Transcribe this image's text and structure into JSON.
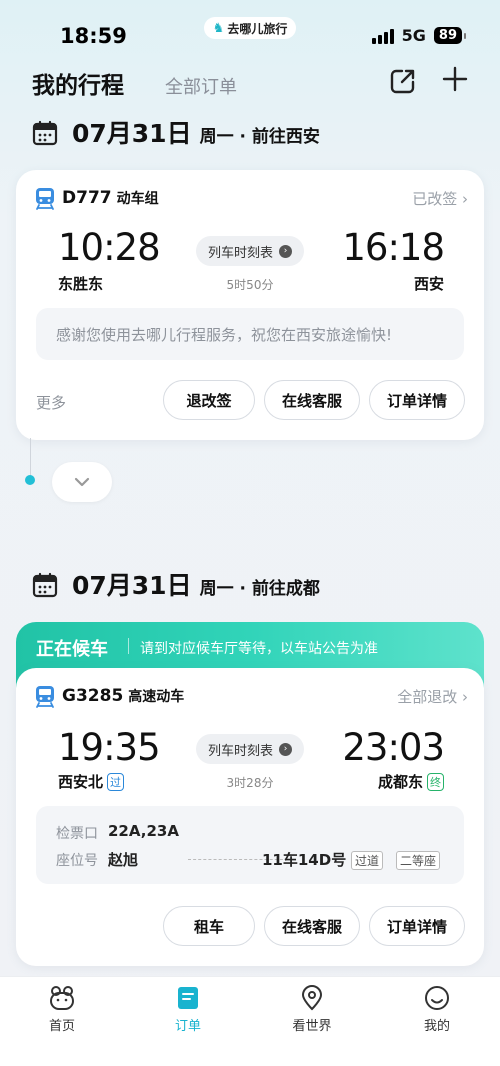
{
  "status_bar": {
    "time": "18:59",
    "app_name": "去哪儿旅行",
    "network": "5G",
    "battery": "89"
  },
  "header": {
    "title": "我的行程",
    "tab_all_orders": "全部订单"
  },
  "trips": [
    {
      "date": "07月31日",
      "weekday_dest": "周一 · 前往西安",
      "train_no": "D777",
      "train_type": "动车组",
      "status": "已改签 ›",
      "depart_time": "10:28",
      "arrive_time": "16:18",
      "depart_station": "东胜东",
      "arrive_station": "西安",
      "schedule_label": "列车时刻表",
      "duration": "5时50分",
      "notice": "感谢您使用去哪儿行程服务，祝您在西安旅途愉快!",
      "more_label": "更多",
      "buttons": [
        "退改签",
        "在线客服",
        "订单详情"
      ]
    },
    {
      "date": "07月31日",
      "weekday_dest": "周一 · 前往成都",
      "banner_title": "正在候车",
      "banner_desc": "请到对应候车厅等待，以车站公告为准",
      "train_no": "G3285",
      "train_type": "高速动车",
      "status": "全部退改 ›",
      "depart_time": "19:35",
      "arrive_time": "23:03",
      "depart_station": "西安北",
      "depart_tag": "过",
      "arrive_station": "成都东",
      "arrive_tag": "终",
      "schedule_label": "列车时刻表",
      "duration": "3时28分",
      "gate_label": "检票口",
      "gate_value": "22A,23A",
      "seat_label": "座位号",
      "passenger": "赵旭",
      "seat_value": "11车14D号",
      "seat_tag1": "过道",
      "seat_tag2": "二等座",
      "buttons": [
        "租车",
        "在线客服",
        "订单详情"
      ]
    }
  ],
  "tabbar": {
    "items": [
      "首页",
      "订单",
      "看世界",
      "我的"
    ],
    "active_color": "#19b3cf"
  },
  "colors": {
    "accent": "#22bfd6",
    "banner": "#21c3a6"
  }
}
